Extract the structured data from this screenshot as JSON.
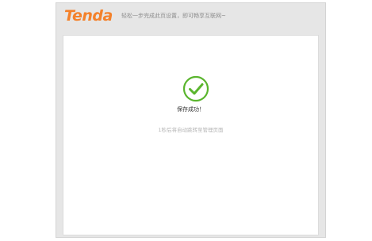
{
  "header": {
    "logo_text": "Tenda",
    "slogan": "轻松一步完成此页设置，即可畅享互联网~"
  },
  "status": {
    "icon": "check-circle-icon",
    "message": "保存成功！",
    "redirect_note": "1秒后将自动跳转至管理页面"
  },
  "colors": {
    "brand": "#f4812a",
    "success": "#5ab52e"
  }
}
